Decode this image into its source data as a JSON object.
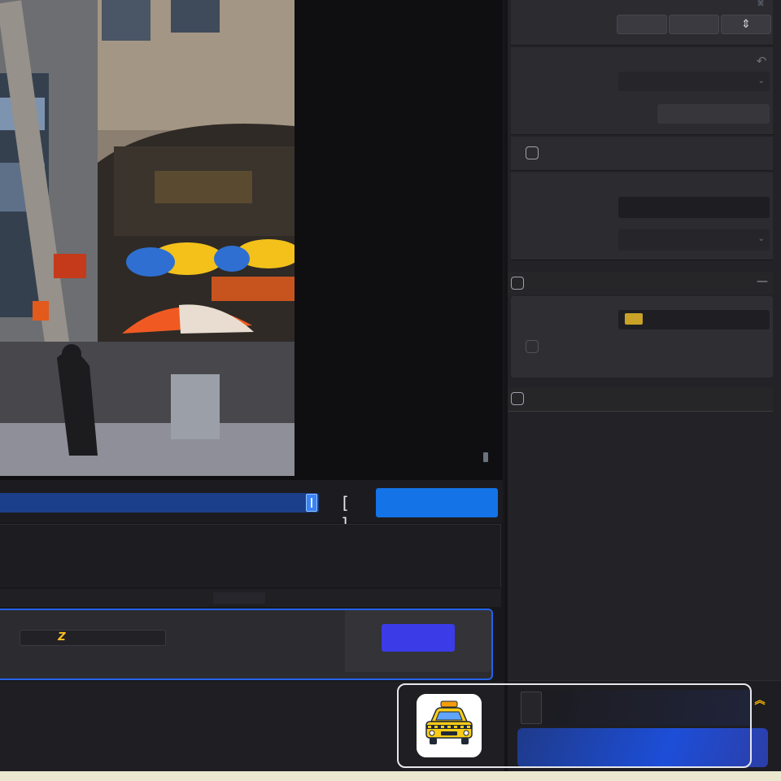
{
  "window": {
    "title": ""
  },
  "preview": {
    "description_icon": "video-preview",
    "zoom_indicator": ""
  },
  "trim": {
    "bracket_label": "[ ]",
    "primary_action_label": ""
  },
  "clip": {
    "input_icon_glyph": "Z",
    "action_label": ""
  },
  "sidebar": {
    "top_corner_glyph": "⌘",
    "segments": [
      {
        "label": ""
      },
      {
        "label": ""
      },
      {
        "label": "⇕"
      }
    ],
    "reset_glyph": "↶",
    "dropdown_chevron": "⌄",
    "collapse_glyph": "—"
  },
  "app_card": {
    "icon": "taxi-icon",
    "expand_glyph": "︽"
  },
  "colors": {
    "accent_blue": "#1473e6",
    "clip_border": "#2563eb",
    "swatch": "#c9a227",
    "expand_icon": "#f5b301"
  }
}
